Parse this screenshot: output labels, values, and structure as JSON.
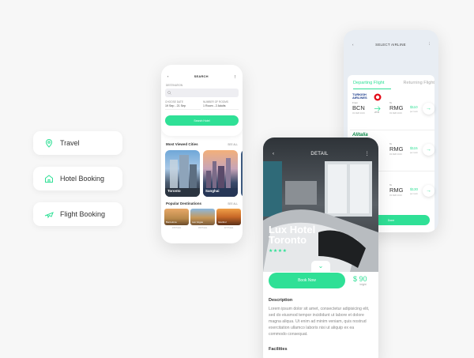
{
  "categories": [
    {
      "label": "Travel",
      "icon": "map-pin-icon"
    },
    {
      "label": "Hotel Booking",
      "icon": "home-icon"
    },
    {
      "label": "Flight Booking",
      "icon": "airplane-icon"
    }
  ],
  "search_screen": {
    "title": "SEARCH",
    "destination_label": "DESTINATION",
    "choose_date_label": "CHOOSE DATE",
    "choose_date_value": "19 Sep - 21 Sep",
    "rooms_label": "NUMBER OF ROOMS",
    "rooms_value": "1 Room - 2 Adults",
    "search_button": "Search Hotel",
    "most_viewed_title": "Most Viewed Cities",
    "see_all": "SEE ALL",
    "cities": [
      "Toronto",
      "Sanghai"
    ],
    "popular_title": "Popular Destinations",
    "popular": [
      {
        "name": "Barcelona",
        "sub": "145 Hotels"
      },
      {
        "name": "Las Vegas",
        "sub": "182 Hotels"
      },
      {
        "name": "Istanbul",
        "sub": "227 Hotels"
      }
    ]
  },
  "airline_screen": {
    "title": "SELECT AIRLINE",
    "tab_departing": "Departing Flight",
    "tab_returning": "Returning Flight",
    "from_label": "From",
    "to_label": "To",
    "flights": [
      {
        "airline": "TURKISH AIRLINES",
        "from": "BCN",
        "to": "RMG",
        "from_date": "03 FEB 2019",
        "to_date": "03 FEB 2019",
        "duration": "2H45",
        "price": "$110",
        "per": "per room"
      },
      {
        "airline": "Alitalia",
        "from": "",
        "to": "RMG",
        "from_date": "",
        "to_date": "03 FEB 2019",
        "duration": "",
        "price": "$115",
        "per": "per room"
      },
      {
        "airline": "",
        "from": "",
        "to": "RMG",
        "from_date": "",
        "to_date": "03 FEB 2019",
        "duration": "",
        "price": "$130",
        "per": "per room"
      }
    ],
    "done_button": "Done"
  },
  "detail_screen": {
    "title": "DETAIL",
    "hotel_name": "Lux Hotel Toronto",
    "stars": "★★★★",
    "book_button": "Book Now",
    "price": "$ 90",
    "per": "/night",
    "description_title": "Description",
    "description": "Lorem ipsum dolor sit amet, consectetur adipisicing elit, sed do eiusmod tempor incididunt ut labore et dolore magna aliqua. Ut enim ad minim veniam, quis nostrud exercitation ullamco laboris nisi ut aliquip ex ea commodo consequat.",
    "facilities_title": "Facilities"
  },
  "colors": {
    "accent": "#2fe096",
    "background": "#f7f7f7"
  }
}
